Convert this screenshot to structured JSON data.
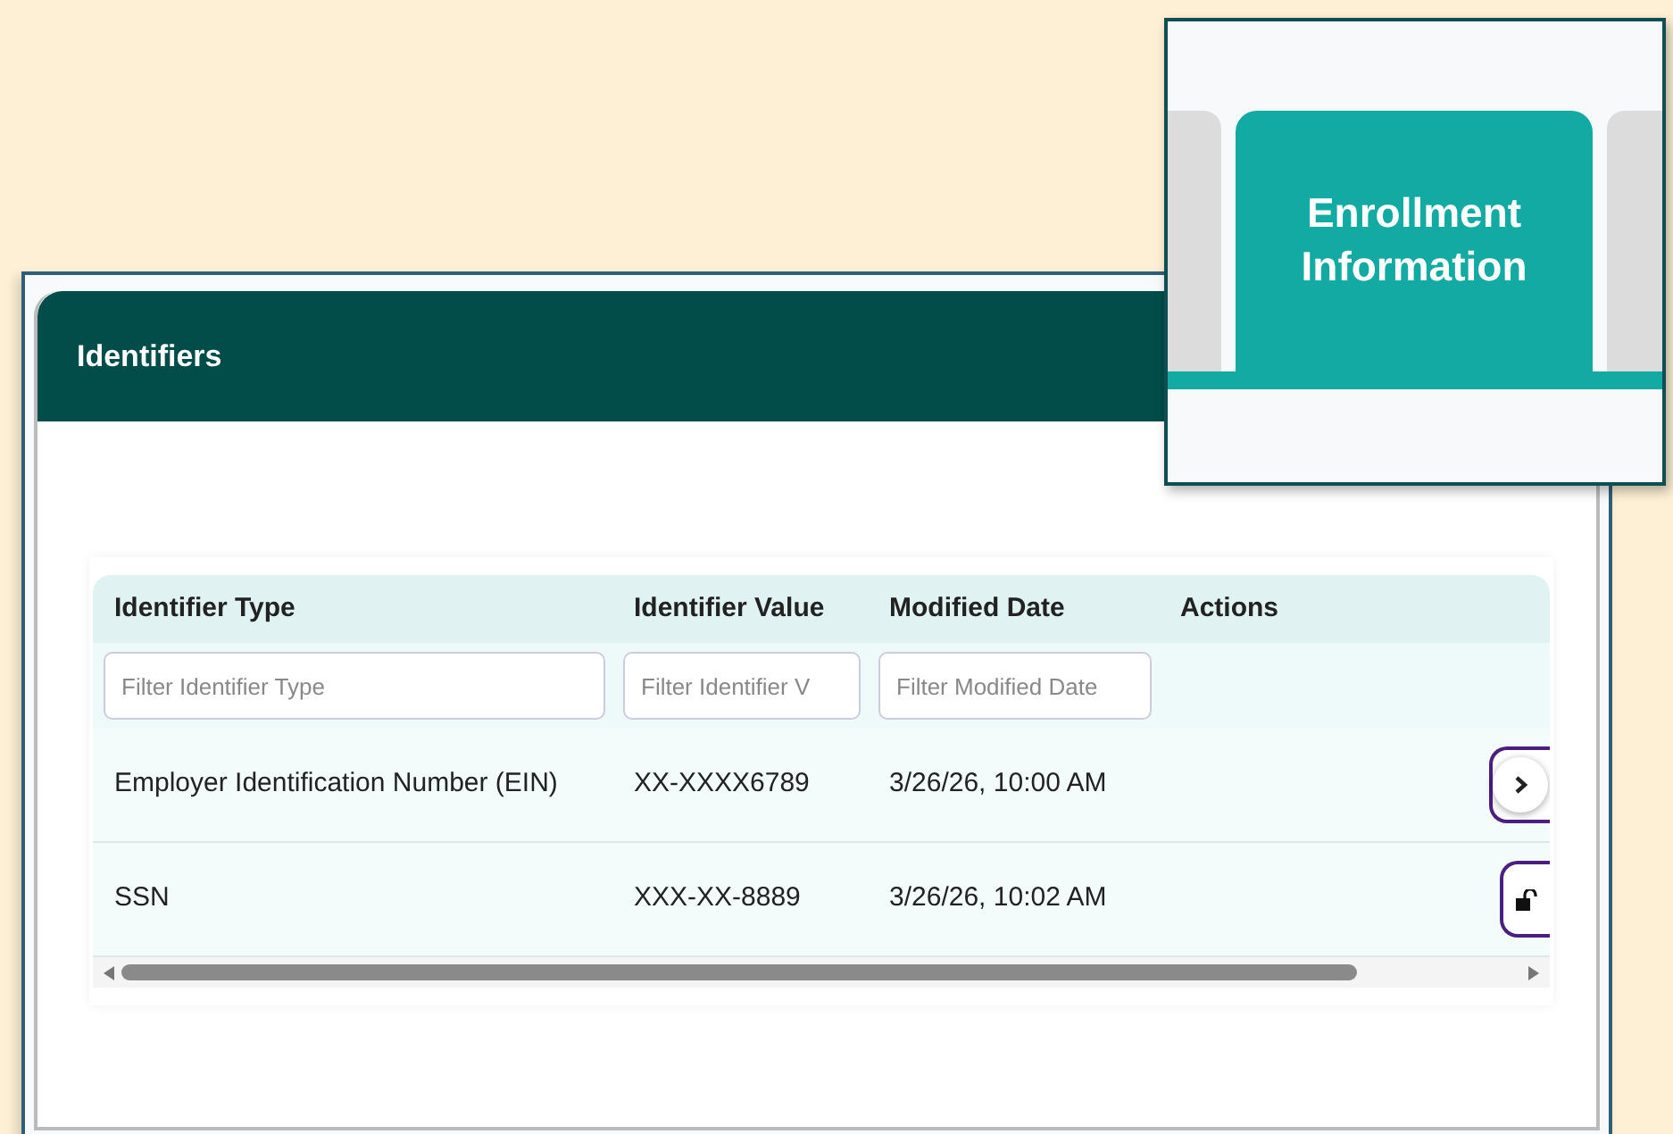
{
  "card": {
    "title": "Identifiers"
  },
  "table": {
    "columns": [
      {
        "label": "Identifier Type",
        "filter_placeholder": "Filter Identifier Type"
      },
      {
        "label": "Identifier Value",
        "filter_placeholder": "Filter Identifier V"
      },
      {
        "label": "Modified Date",
        "filter_placeholder": "Filter Modified Date"
      },
      {
        "label": "Actions"
      }
    ],
    "rows": [
      {
        "cells": [
          "Employer Identification Number (EIN)",
          "XX-XXXX6789",
          "3/26/26, 10:00 AM"
        ],
        "action": {
          "kind": "expand"
        }
      },
      {
        "cells": [
          "SSN",
          "XXX-XX-8889",
          "3/26/26, 10:02 AM"
        ],
        "action": {
          "kind": "unlock"
        }
      }
    ]
  },
  "inset": {
    "tab": {
      "label": "Enrollment Information",
      "selected": true
    }
  }
}
